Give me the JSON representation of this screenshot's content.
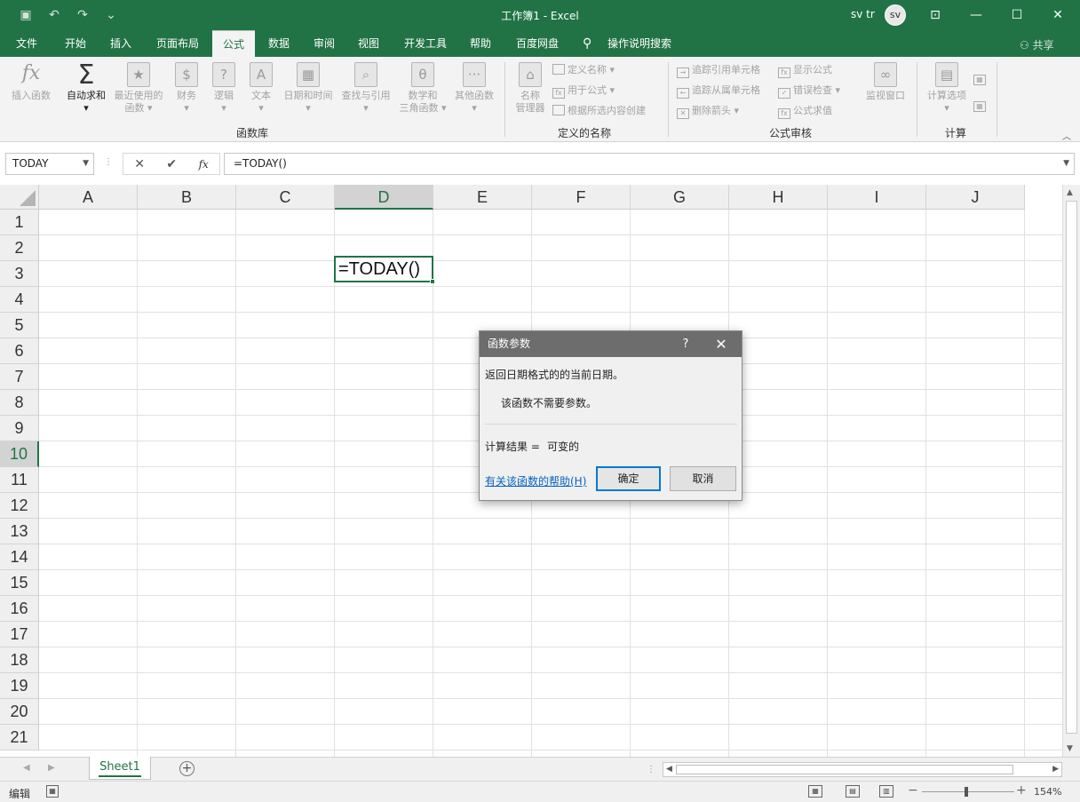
{
  "window": {
    "title": "工作簿1  -  Excel",
    "user": "sv tr",
    "avatar_initials": "sv"
  },
  "quick_access": [
    "save-icon",
    "undo-icon",
    "redo-icon",
    "customize-icon"
  ],
  "menu_tabs": [
    {
      "label": "文件"
    },
    {
      "label": "开始"
    },
    {
      "label": "插入"
    },
    {
      "label": "页面布局"
    },
    {
      "label": "公式",
      "active": true
    },
    {
      "label": "数据"
    },
    {
      "label": "审阅"
    },
    {
      "label": "视图"
    },
    {
      "label": "开发工具"
    },
    {
      "label": "帮助"
    },
    {
      "label": "百度网盘"
    }
  ],
  "tell_me": "操作说明搜索",
  "share": "共享",
  "ribbon": {
    "insert_function": "插入函数",
    "autosum_line1": "自动求和",
    "recent_line1": "最近使用的",
    "recent_line2": "函数",
    "financial": "财务",
    "logical": "逻辑",
    "text": "文本",
    "datetime": "日期和时间",
    "lookup": "查找与引用",
    "math_line1": "数学和",
    "math_line2": "三角函数",
    "more": "其他函数",
    "group_library": "函数库",
    "name_manager_line1": "名称",
    "name_manager_line2": "管理器",
    "define_name": "定义名称",
    "use_in_formula": "用于公式",
    "create_from_selection": "根据所选内容创建",
    "group_names": "定义的名称",
    "trace_precedents": "追踪引用单元格",
    "trace_dependents": "追踪从属单元格",
    "remove_arrows": "删除箭头",
    "show_formulas": "显示公式",
    "error_checking": "错误检查",
    "evaluate_formula": "公式求值",
    "watch_window": "监视窗口",
    "group_auditing": "公式审核",
    "calc_options": "计算选项",
    "group_calc": "计算"
  },
  "formula_bar": {
    "name_box": "TODAY",
    "formula": "=TODAY()",
    "fx": "fx"
  },
  "columns": [
    "A",
    "B",
    "C",
    "D",
    "E",
    "F",
    "G",
    "H",
    "I",
    "J"
  ],
  "rows": [
    "1",
    "2",
    "3",
    "4",
    "5",
    "6",
    "7",
    "8",
    "9",
    "10",
    "11",
    "12",
    "13",
    "14",
    "15",
    "16",
    "17",
    "18",
    "19",
    "20",
    "21"
  ],
  "active_cell": {
    "column": "D",
    "row": "10",
    "content": "=TODAY()"
  },
  "dialog": {
    "title": "函数参数",
    "help_glyph": "?",
    "description": "返回日期格式的的当前日期。",
    "no_args": "该函数不需要参数。",
    "result_label": "计算结果 =",
    "result_value": "可变的",
    "help_link": "有关该函数的帮助(H)",
    "ok": "确定",
    "cancel": "取消"
  },
  "sheet": {
    "tab": "Sheet1"
  },
  "status": {
    "mode": "编辑",
    "zoom": "154%"
  },
  "colors": {
    "accent": "#217346",
    "link": "#0563c1",
    "dialog_title": "#6d6d6d"
  }
}
